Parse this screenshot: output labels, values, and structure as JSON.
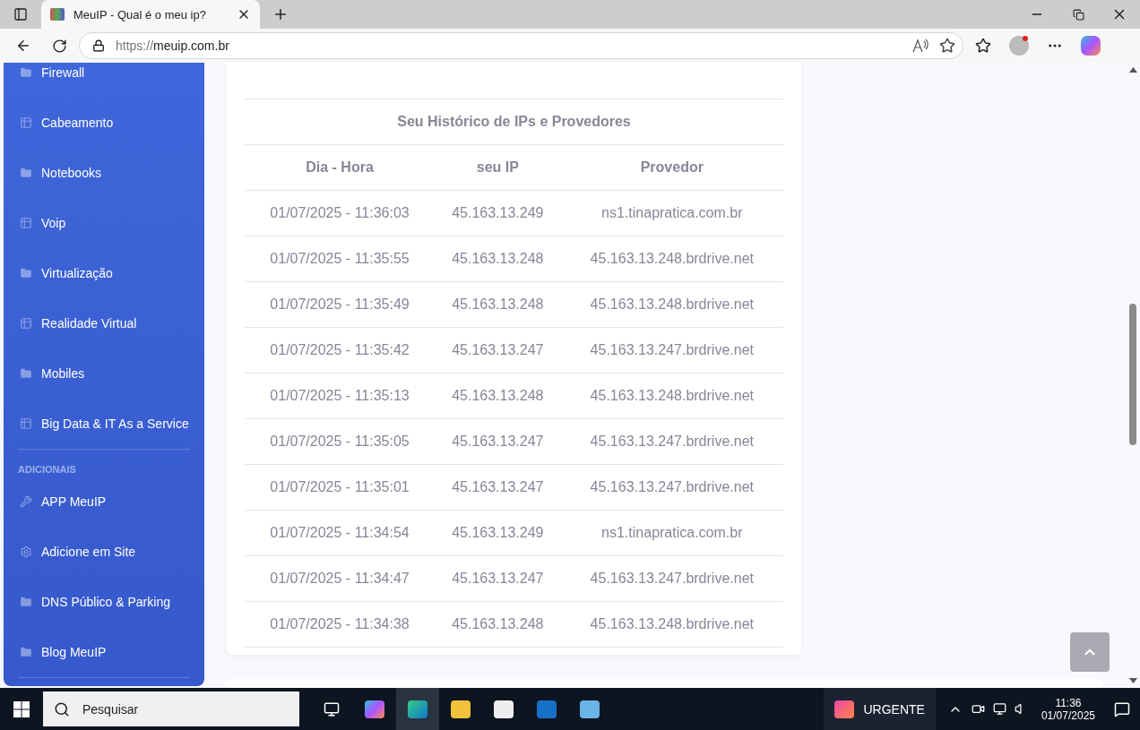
{
  "browser": {
    "tab_title": "MeuIP - Qual é o meu ip?",
    "url_scheme": "https://",
    "url_host": "meuip.com.br"
  },
  "sidebar": {
    "items": [
      {
        "label": "Firewall",
        "kind": "folder"
      },
      {
        "label": "Cabeamento",
        "kind": "table"
      },
      {
        "label": "Notebooks",
        "kind": "folder"
      },
      {
        "label": "Voip",
        "kind": "table"
      },
      {
        "label": "Virtualização",
        "kind": "folder"
      },
      {
        "label": "Realidade Virtual",
        "kind": "table"
      },
      {
        "label": "Mobiles",
        "kind": "folder"
      },
      {
        "label": "Big Data & IT As a Service",
        "kind": "table"
      }
    ],
    "section_heading": "ADICIONAIS",
    "extra_items": [
      {
        "label": "APP MeuIP",
        "kind": "wrench"
      },
      {
        "label": "Adicione em Site",
        "kind": "gear"
      },
      {
        "label": "DNS Público & Parking",
        "kind": "folder"
      },
      {
        "label": "Blog MeuIP",
        "kind": "folder"
      }
    ]
  },
  "history": {
    "title": "Seu Histórico de IPs e Provedores",
    "columns": [
      "Dia - Hora",
      "seu IP",
      "Provedor"
    ],
    "rows": [
      [
        "01/07/2025 - 11:36:03",
        "45.163.13.249",
        "ns1.tinapratica.com.br"
      ],
      [
        "01/07/2025 - 11:35:55",
        "45.163.13.248",
        "45.163.13.248.brdrive.net"
      ],
      [
        "01/07/2025 - 11:35:49",
        "45.163.13.248",
        "45.163.13.248.brdrive.net"
      ],
      [
        "01/07/2025 - 11:35:42",
        "45.163.13.247",
        "45.163.13.247.brdrive.net"
      ],
      [
        "01/07/2025 - 11:35:13",
        "45.163.13.248",
        "45.163.13.248.brdrive.net"
      ],
      [
        "01/07/2025 - 11:35:05",
        "45.163.13.247",
        "45.163.13.247.brdrive.net"
      ],
      [
        "01/07/2025 - 11:35:01",
        "45.163.13.247",
        "45.163.13.247.brdrive.net"
      ],
      [
        "01/07/2025 - 11:34:54",
        "45.163.13.249",
        "ns1.tinapratica.com.br"
      ],
      [
        "01/07/2025 - 11:34:47",
        "45.163.13.247",
        "45.163.13.247.brdrive.net"
      ],
      [
        "01/07/2025 - 11:34:38",
        "45.163.13.248",
        "45.163.13.248.brdrive.net"
      ]
    ]
  },
  "taskbar": {
    "search_placeholder": "Pesquisar",
    "widget_label": "URGENTE",
    "time": "11:36",
    "date": "01/07/2025"
  }
}
